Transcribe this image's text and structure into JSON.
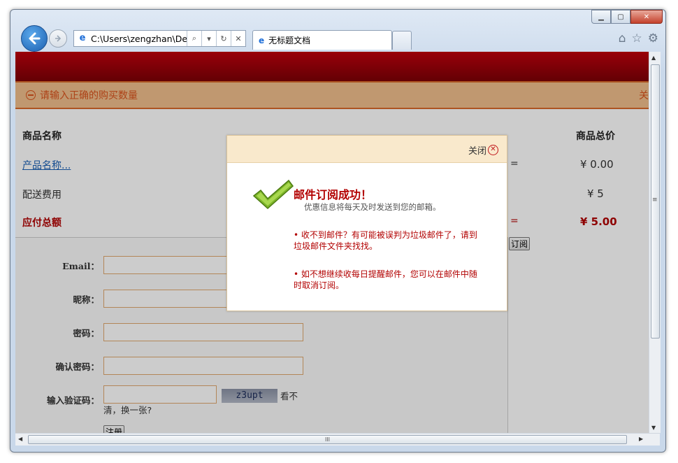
{
  "browser": {
    "address": "C:\\Users\\zengzhan\\Desk",
    "tab_title": "无标题文档",
    "scroll_h_grip": "III",
    "scroll_v_grip": "≡"
  },
  "page": {
    "error_message": "请输入正确的购买数量",
    "error_right": "关",
    "cart": {
      "col_name": "商品名称",
      "col_total": "商品总价",
      "product_link": "产品名称...",
      "eq1": "=",
      "product_total": "¥ 0.00",
      "shipping_label": "配送费用",
      "shipping_value": "¥ 5",
      "payable_label": "应付总额",
      "eq2": "=",
      "payable_value": "¥ 5.00",
      "subscribe_button": "订阅"
    },
    "form": {
      "email_label": "Email：",
      "nickname_label": "昵称：",
      "password_label": "密码：",
      "confirm_label": "确认密码：",
      "captcha_label": "输入验证码：",
      "captcha_text": "z3upt",
      "captcha_refresh_1": "看不",
      "captcha_refresh_2": "清，换一张?",
      "register_button": "注册"
    }
  },
  "modal": {
    "close_label": "关闭",
    "title": "邮件订阅成功！",
    "subtitle": "优惠信息将每天及时发送到您的邮箱。",
    "bullet1": "• 收不到邮件？有可能被误判为垃圾邮件了，请到垃圾邮件文件夹找找。",
    "bullet2": "• 如不想继续收每日提醒邮件，您可以在邮件中随时取消订阅。"
  },
  "colors": {
    "brand_red": "#b20000",
    "error_orange": "#d9531d"
  }
}
